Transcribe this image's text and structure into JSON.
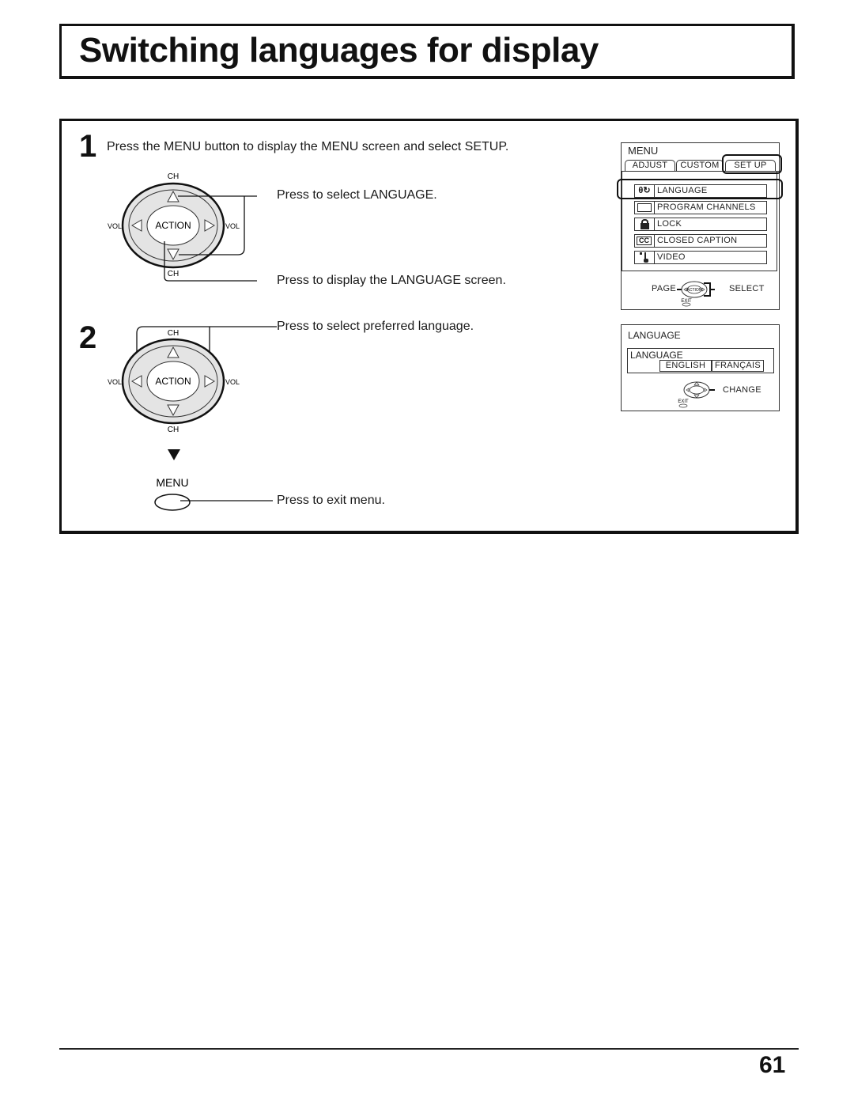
{
  "page": {
    "title": "Switching languages for display",
    "page_number": "61"
  },
  "steps": [
    {
      "number": "1",
      "text": "Press the MENU button to display the MENU screen and select SETUP.",
      "callouts": [
        "Press to select LANGUAGE.",
        "Press to display the LANGUAGE  screen."
      ]
    },
    {
      "number": "2",
      "callouts": [
        "Press to select preferred language.",
        "Press to exit menu."
      ]
    }
  ],
  "remote": {
    "ch_label": "CH",
    "vol_label": "VOL",
    "action_label": "ACTION",
    "menu_label": "MENU"
  },
  "menu_screen": {
    "title": "MENU",
    "tabs": [
      "ADJUST",
      "CUSTOM",
      "SET  UP"
    ],
    "active_tab": "SET  UP",
    "items": [
      {
        "icon": "language-icon",
        "label": "LANGUAGE",
        "highlighted": true
      },
      {
        "icon": "tv-screen-icon",
        "label": "PROGRAM  CHANNELS"
      },
      {
        "icon": "lock-icon",
        "label": "LOCK"
      },
      {
        "icon": "closed-caption-icon",
        "label": "CLOSED  CAPTION"
      },
      {
        "icon": "video-icon",
        "label": "VIDEO"
      }
    ],
    "cc_glyph": "CC",
    "footer_left": "PAGE",
    "footer_right": "SELECT",
    "exit_label": "EXIT",
    "action_label": "ACTION"
  },
  "language_screen": {
    "title": "LANGUAGE",
    "field_label": "LANGUAGE",
    "options": [
      "ENGLISH",
      "FRANÇAIS"
    ],
    "selected": "ENGLISH",
    "footer_right": "CHANGE",
    "exit_label": "EXIT"
  }
}
